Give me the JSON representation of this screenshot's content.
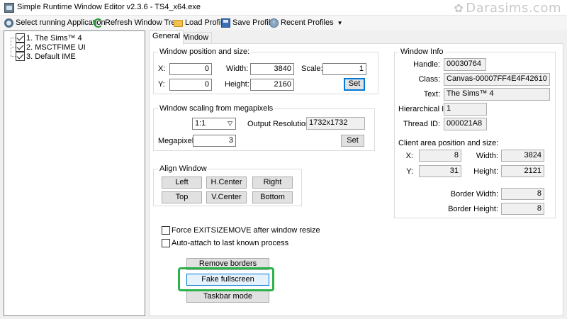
{
  "window": {
    "title": "Simple Runtime Window Editor v2.3.6 - TS4_x64.exe",
    "watermark": "Darasims.com"
  },
  "toolbar": {
    "select_app": "Select running Application",
    "refresh_tree": "Refresh Window Tree",
    "load_profile": "Load Profile",
    "save_profile": "Save Profile",
    "recent_profiles": "Recent Profiles"
  },
  "tree": {
    "items": [
      {
        "label": "1. The Sims™ 4",
        "checked": true
      },
      {
        "label": "2. MSCTFIME UI",
        "checked": true
      },
      {
        "label": "3. Default IME",
        "checked": true
      }
    ]
  },
  "tabs": [
    "General",
    "Window Styles"
  ],
  "position": {
    "title": "Window position and size:",
    "x_label": "X:",
    "x": "0",
    "y_label": "Y:",
    "y": "0",
    "width_label": "Width:",
    "width": "3840",
    "height_label": "Height:",
    "height": "2160",
    "scale_label": "Scale:",
    "scale": "1",
    "set": "Set"
  },
  "scaling": {
    "title": "Window scaling from megapixels",
    "ratio": "1:1",
    "output_label": "Output Resolution:",
    "output": "1732x1732",
    "megapixels_label": "Megapixels:",
    "megapixels": "3",
    "set": "Set"
  },
  "align": {
    "title": "Align Window",
    "left": "Left",
    "hcenter": "H.Center",
    "right": "Right",
    "top": "Top",
    "vcenter": "V.Center",
    "bottom": "Bottom"
  },
  "options": {
    "force_exitsizemove": "Force EXITSIZEMOVE after window resize",
    "auto_attach": "Auto-attach to last known process"
  },
  "actions": {
    "remove_borders": "Remove borders",
    "fake_fullscreen": "Fake fullscreen",
    "taskbar_mode": "Taskbar mode"
  },
  "info": {
    "title": "Window Info",
    "handle_label": "Handle:",
    "handle": "00030764",
    "class_label": "Class:",
    "class": "Canvas-00007FF4E4F42610",
    "text_label": "Text:",
    "text": "The Sims™ 4",
    "hier_label": "Hierarchical ID:",
    "hier": "1",
    "thread_label": "Thread ID:",
    "thread": "000021A8",
    "client_title": "Client area position and size:",
    "cx_label": "X:",
    "cx": "8",
    "cy_label": "Y:",
    "cy": "31",
    "cw_label": "Width:",
    "cw": "3824",
    "ch_label": "Height:",
    "ch": "2121",
    "bw_label": "Border Width:",
    "bw": "8",
    "bh_label": "Border Height:",
    "bh": "8"
  },
  "colors": {
    "highlight": "#2bb24c",
    "focus": "#0078d7"
  }
}
